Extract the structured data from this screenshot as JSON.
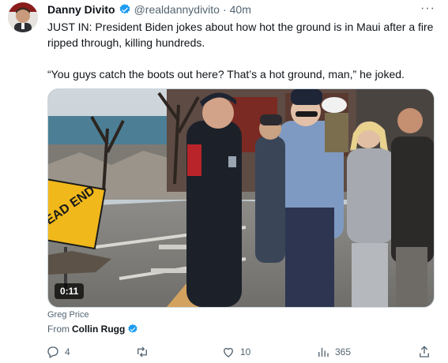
{
  "tweet": {
    "display_name": "Danny Divito",
    "handle": "@realdannydivito",
    "separator": "·",
    "time": "40m",
    "more": "···",
    "paragraph_1": "JUST IN: President Biden jokes about how hot the ground is in Maui after a fire ripped through, killing hundreds.",
    "paragraph_2": "“You guys catch the boots out here? That’s a hot ground, man,” he joked."
  },
  "media": {
    "duration": "0:11",
    "sign_text": "DEAD END"
  },
  "credit": {
    "name": "Greg Price",
    "from_label": "From",
    "from_user": "Collin Rugg"
  },
  "actions": {
    "replies": "4",
    "retweets": "",
    "likes": "10",
    "views": "365"
  },
  "colors": {
    "verified": "#1d9bf0",
    "text": "#0f1419",
    "secondary": "#536471"
  }
}
